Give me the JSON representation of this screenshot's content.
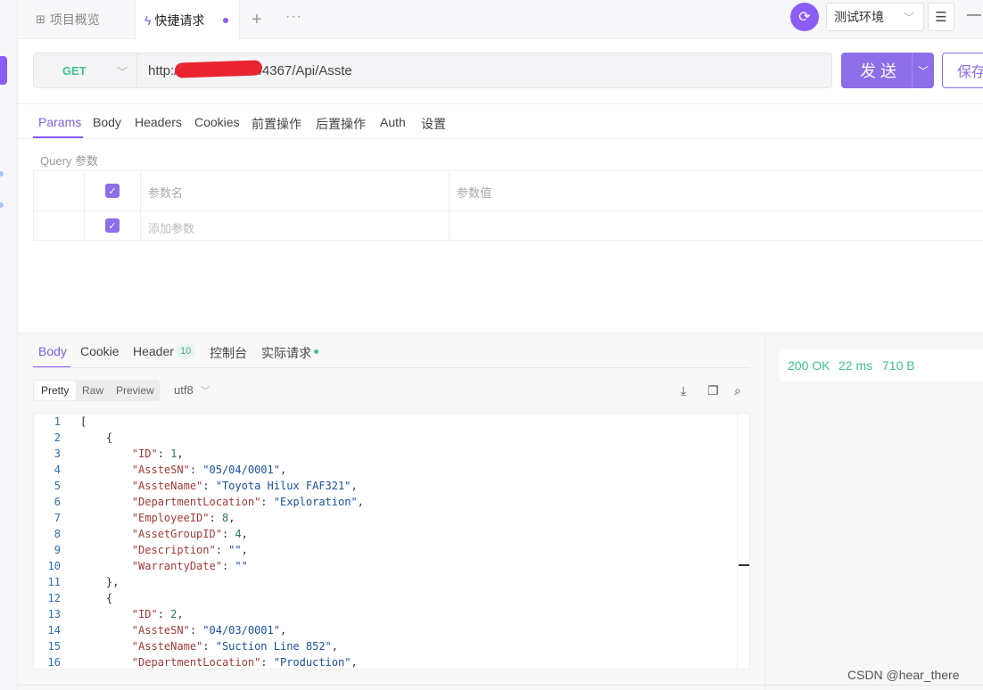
{
  "tabs": {
    "overview_label": "项目概览",
    "quick_label": "快捷请求"
  },
  "env": {
    "selected": "测试环境"
  },
  "request": {
    "method": "GET",
    "url": "http://[REDACTED]:44367/Api/Asste",
    "url_visible_prefix": "http://",
    "url_visible_suffix": "44367/Api/Asste",
    "send_label": "发 送",
    "save_label": "保存"
  },
  "request_tabs": [
    "Params",
    "Body",
    "Headers",
    "Cookies",
    "前置操作",
    "后置操作",
    "Auth",
    "设置"
  ],
  "query": {
    "label": "Query 参数",
    "name_header": "参数名",
    "value_header": "参数值",
    "add_placeholder": "添加参数"
  },
  "response_tabs": {
    "body": "Body",
    "cookie": "Cookie",
    "header": "Header",
    "header_count": "10",
    "console": "控制台",
    "actual": "实际请求"
  },
  "format": {
    "pretty": "Pretty",
    "raw": "Raw",
    "preview": "Preview",
    "encoding": "utf8"
  },
  "status": {
    "code": "200 OK",
    "time": "22 ms",
    "size": "710 B"
  },
  "code_lines": [
    "[",
    "    {",
    "        \"ID\": 1,",
    "        \"AssteSN\": \"05/04/0001\",",
    "        \"AssteName\": \"Toyota Hilux FAF321\",",
    "        \"DepartmentLocation\": \"Exploration\",",
    "        \"EmployeeID\": 8,",
    "        \"AssetGroupID\": 4,",
    "        \"Description\": \"\",",
    "        \"WarrantyDate\": \"\"",
    "    },",
    "    {",
    "        \"ID\": 2,",
    "        \"AssteSN\": \"04/03/0001\",",
    "        \"AssteName\": \"Suction Line 852\",",
    "        \"DepartmentLocation\": \"Production\","
  ],
  "line_numbers": [
    "1",
    "2",
    "3",
    "4",
    "5",
    "6",
    "7",
    "8",
    "9",
    "10",
    "11",
    "12",
    "13",
    "14",
    "15",
    "16"
  ],
  "watermark": "CSDN @hear_there",
  "colors": {
    "accent": "#8b5cf6",
    "success": "#3ec28f",
    "redaction": "#e8242e"
  }
}
